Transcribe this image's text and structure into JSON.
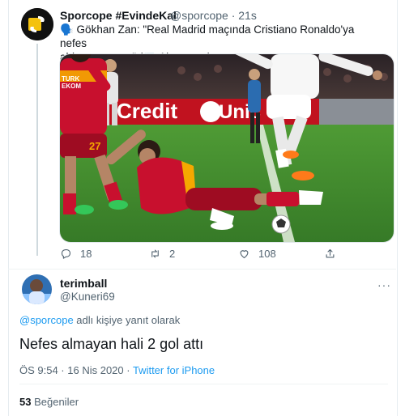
{
  "tweet": {
    "author_name": "Sporcope #EvindeKal",
    "author_handle": "@sporcope",
    "time_sep": "·",
    "time": "21s",
    "text_line1": "🗣️ Gökhan Zan: \"Real Madrid maçında Cristiano Ronaldo'ya nefes",
    "text_line2": "aldırmamıştım.\" (💻 Ajansspor)",
    "image_banner_text": "Credit",
    "image_banner_text2": "Unic",
    "jersey_number": "27",
    "image_sponsor_text": "TURK\nTELEKOM",
    "counts": {
      "replies": "18",
      "retweets": "2",
      "likes": "108"
    }
  },
  "reply": {
    "author_name": "terimball",
    "author_handle": "@Kuneri69",
    "more": "···",
    "replying_to_mention": "@sporcope",
    "replying_to_suffix": " adlı kişiye yanıt olarak",
    "text": "Nefes almayan hali 2 gol attı",
    "timestamp": "ÖS 9:54 · 16 Nis 2020 · ",
    "source": "Twitter for iPhone",
    "likes_count": "53",
    "likes_label": "Beğeniler"
  },
  "icons": [
    "reply-icon",
    "retweet-icon",
    "like-icon",
    "share-icon"
  ],
  "colors": {
    "accent": "#1d9bf0",
    "muted": "#536471",
    "gala_red": "#c8102e",
    "gala_yellow": "#f5a800",
    "pitch": "#3f8d2f"
  }
}
